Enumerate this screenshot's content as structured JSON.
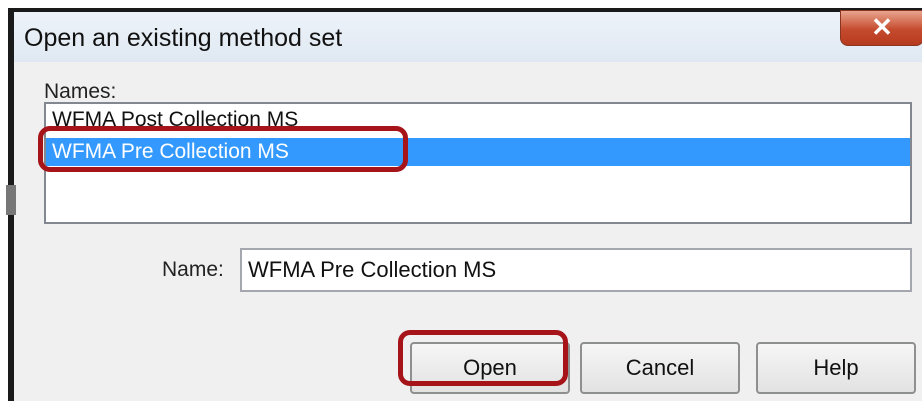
{
  "window": {
    "title": "Open an existing method set",
    "close_glyph": "✕"
  },
  "names": {
    "label": "Names:",
    "items": [
      {
        "label": "WFMA Post Collection MS",
        "selected": false
      },
      {
        "label": "WFMA Pre Collection MS",
        "selected": true
      }
    ]
  },
  "name_field": {
    "label": "Name:",
    "value": "WFMA Pre Collection MS"
  },
  "buttons": {
    "open": "Open",
    "cancel": "Cancel",
    "help": "Help"
  },
  "colors": {
    "selection": "#3399ff",
    "annotation": "#a6141a"
  }
}
